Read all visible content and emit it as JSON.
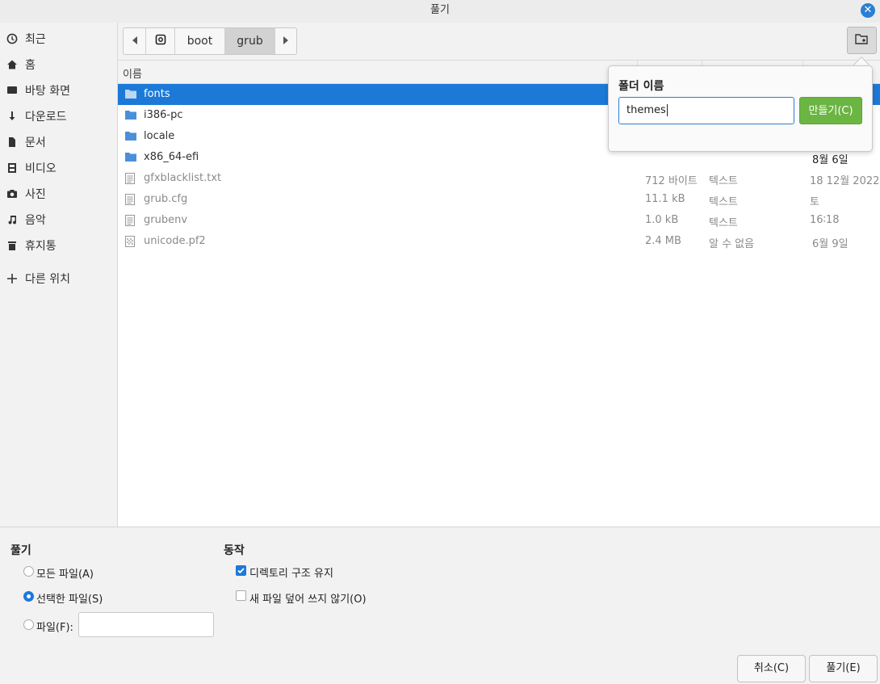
{
  "window": {
    "title": "풀기"
  },
  "sidebar": {
    "items": [
      {
        "label": "최근",
        "icon": "clock-icon"
      },
      {
        "label": "홈",
        "icon": "home-icon"
      },
      {
        "label": "바탕 화면",
        "icon": "desktop-icon"
      },
      {
        "label": "다운로드",
        "icon": "download-icon"
      },
      {
        "label": "문서",
        "icon": "document-icon"
      },
      {
        "label": "비디오",
        "icon": "video-icon"
      },
      {
        "label": "사진",
        "icon": "camera-icon"
      },
      {
        "label": "음악",
        "icon": "music-icon"
      },
      {
        "label": "휴지통",
        "icon": "trash-icon"
      },
      {
        "label": "다른 위치",
        "icon": "plus-icon"
      }
    ]
  },
  "pathbar": {
    "crumbs": [
      "boot",
      "grub"
    ],
    "active_crumb": "grub"
  },
  "filelist": {
    "columns": {
      "name": "이름"
    },
    "rows": [
      {
        "name": "fonts",
        "size": "",
        "type": "",
        "modified": "",
        "kind": "folder",
        "selected": true
      },
      {
        "name": "i386-pc",
        "size": "",
        "type": "",
        "modified": "",
        "kind": "folder"
      },
      {
        "name": "locale",
        "size": "",
        "type": "",
        "modified": "",
        "kind": "folder"
      },
      {
        "name": "x86_64-efi",
        "size": "",
        "type": "",
        "modified": "8월 6일",
        "kind": "folder"
      },
      {
        "name": "gfxblacklist.txt",
        "size": "712 바이트",
        "type": "텍스트",
        "modified": "18 12월 2022",
        "kind": "text"
      },
      {
        "name": "grub.cfg",
        "size": "11.1 kB",
        "type": "텍스트",
        "modified": "토",
        "kind": "text"
      },
      {
        "name": "grubenv",
        "size": "1.0 kB",
        "type": "텍스트",
        "modified": "16∶18",
        "kind": "text"
      },
      {
        "name": "unicode.pf2",
        "size": "2.4 MB",
        "type": "알 수 없음",
        "modified": "6월 9일",
        "kind": "binary"
      }
    ]
  },
  "new_folder_popover": {
    "title": "폴더 이름",
    "input_value": "themes",
    "create_label": "만들기(C)"
  },
  "options": {
    "extract": {
      "heading": "풀기",
      "all_files": "모든 파일(A)",
      "selected_files": "선택한 파일(S)",
      "files": "파일(F):",
      "files_value": ""
    },
    "actions": {
      "heading": "동작",
      "keep_structure": "디렉토리 구조 유지",
      "no_overwrite": "새 파일 덮어 쓰지 않기(O)"
    }
  },
  "buttons": {
    "cancel": "취소(C)",
    "extract": "풀기(E)"
  },
  "colors": {
    "selection": "#1c79d7",
    "accent_green": "#6bb542",
    "close": "#2a7fd4"
  }
}
